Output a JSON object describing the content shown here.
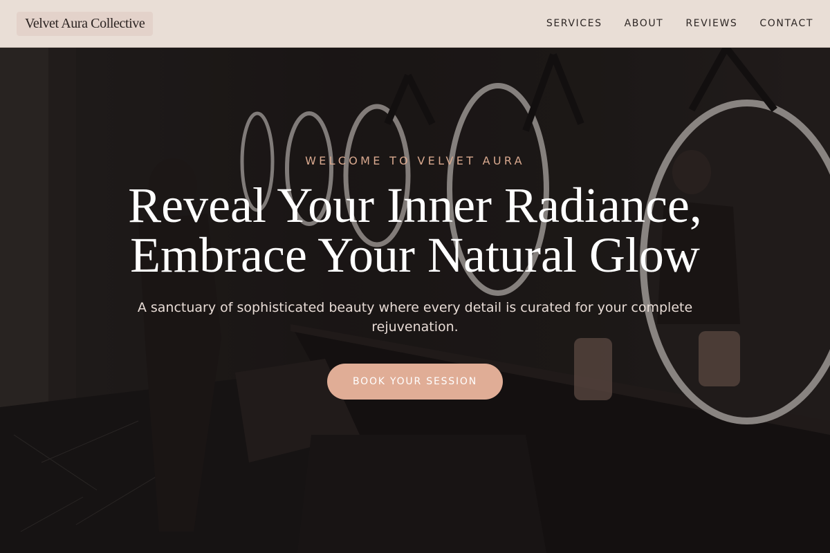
{
  "header": {
    "brand": "Velvet Aura Collective",
    "nav": [
      "SERVICES",
      "ABOUT",
      "REVIEWS",
      "CONTACT"
    ]
  },
  "hero": {
    "eyebrow": "WELCOME TO VELVET AURA",
    "headline_line1": "Reveal Your Inner Radiance,",
    "headline_line2": "Embrace Your Natural Glow",
    "subtitle": "A sanctuary of sophisticated beauty where every detail is curated for your complete rejuvenation.",
    "cta": "BOOK YOUR SESSION"
  },
  "colors": {
    "header_bg": "#e9ded6",
    "accent": "#e0ad96",
    "eyebrow": "#d9a98f"
  }
}
